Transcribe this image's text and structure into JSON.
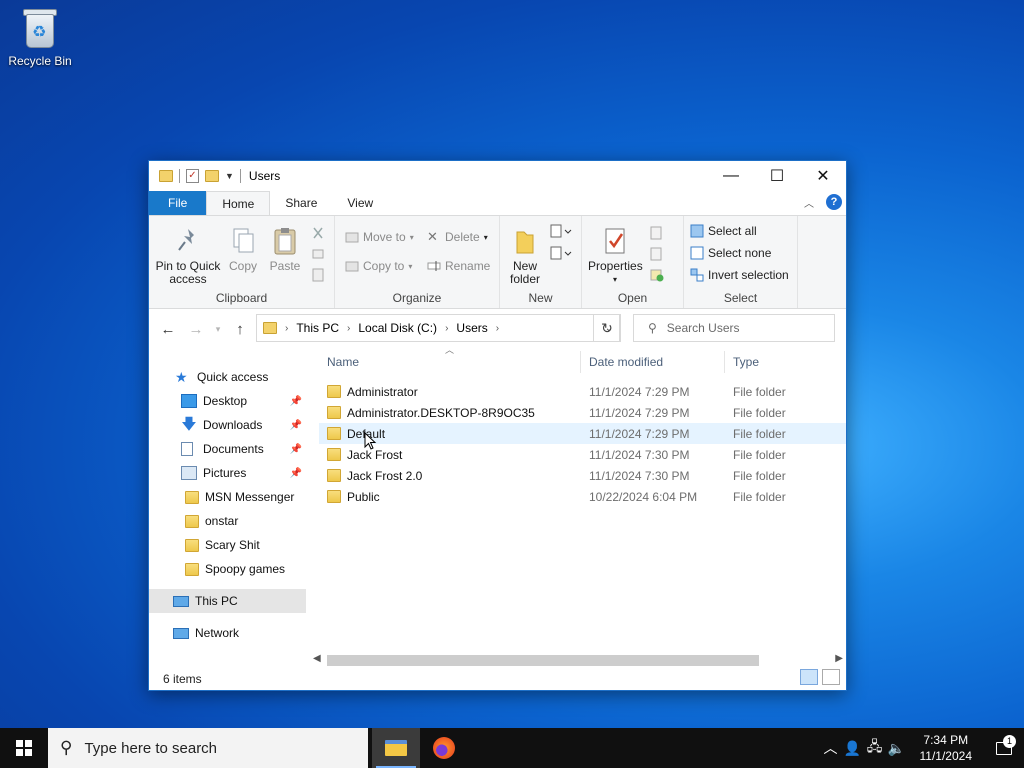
{
  "desktop": {
    "recycle_bin_label": "Recycle Bin"
  },
  "window": {
    "title": "Users",
    "controls": {
      "minimize": "—",
      "maximize": "☐",
      "close": "✕"
    }
  },
  "ribbon_tabs": [
    "File",
    "Home",
    "Share",
    "View"
  ],
  "ribbon": {
    "clipboard": {
      "pin_label_1": "Pin to Quick",
      "pin_label_2": "access",
      "copy": "Copy",
      "paste": "Paste",
      "group": "Clipboard"
    },
    "organize": {
      "move_to": "Move to",
      "copy_to": "Copy to",
      "delete": "Delete",
      "rename": "Rename",
      "group": "Organize"
    },
    "new": {
      "new_folder_1": "New",
      "new_folder_2": "folder",
      "group": "New"
    },
    "open": {
      "properties": "Properties",
      "group": "Open"
    },
    "select": {
      "select_all": "Select all",
      "select_none": "Select none",
      "invert_selection": "Invert selection",
      "group": "Select"
    }
  },
  "address": {
    "crumbs": [
      "This PC",
      "Local Disk (C:)",
      "Users"
    ],
    "search_placeholder": "Search Users"
  },
  "nav": {
    "quick_access": "Quick access",
    "pinned": [
      "Desktop",
      "Downloads",
      "Documents",
      "Pictures"
    ],
    "folders": [
      "MSN Messenger",
      "onstar",
      "Scary Shit",
      "Spoopy games"
    ],
    "this_pc": "This PC",
    "network": "Network"
  },
  "columns": {
    "name": "Name",
    "date": "Date modified",
    "type": "Type"
  },
  "files": [
    {
      "name": "Administrator",
      "date": "11/1/2024 7:29 PM",
      "type": "File folder"
    },
    {
      "name": "Administrator.DESKTOP-8R9OC35",
      "date": "11/1/2024 7:29 PM",
      "type": "File folder"
    },
    {
      "name": "Default",
      "date": "11/1/2024 7:29 PM",
      "type": "File folder"
    },
    {
      "name": "Jack Frost",
      "date": "11/1/2024 7:30 PM",
      "type": "File folder"
    },
    {
      "name": "Jack Frost 2.0",
      "date": "11/1/2024 7:30 PM",
      "type": "File folder"
    },
    {
      "name": "Public",
      "date": "10/22/2024 6:04 PM",
      "type": "File folder"
    }
  ],
  "status": {
    "item_count": "6 items"
  },
  "taskbar": {
    "search_placeholder": "Type here to search",
    "time": "7:34 PM",
    "date": "11/1/2024",
    "notification_count": "1"
  },
  "colors": {
    "accent": "#1979ca",
    "hover_row": "#e5f3ff",
    "desktop": "#0b63cf"
  }
}
